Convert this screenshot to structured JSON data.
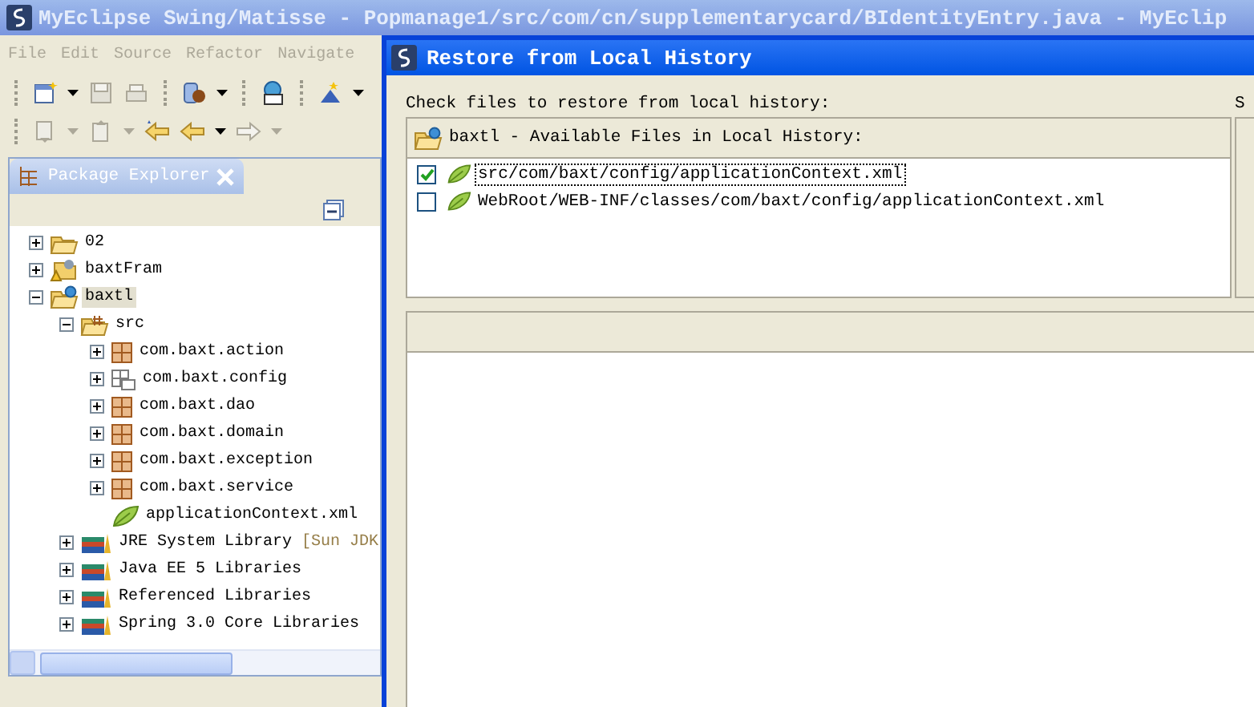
{
  "window": {
    "title": "MyEclipse Swing/Matisse - Popmanage1/src/com/cn/supplementarycard/BIdentityEntry.java - MyEclip"
  },
  "menu": [
    "File",
    "Edit",
    "Source",
    "Refactor",
    "Navigate"
  ],
  "package_explorer": {
    "title": "Package Explorer",
    "tree": [
      {
        "label": "02",
        "kind": "folder",
        "expanded": false,
        "selected": false
      },
      {
        "label": "baxtFram",
        "kind": "warning-project",
        "expanded": false,
        "selected": false
      },
      {
        "label": "baxtl",
        "kind": "project",
        "expanded": true,
        "selected": true,
        "children": [
          {
            "label": "src",
            "kind": "source-folder",
            "expanded": true,
            "selected": false,
            "children": [
              {
                "label": "com.baxt.action",
                "kind": "package",
                "expanded": false,
                "selected": false
              },
              {
                "label": "com.baxt.config",
                "kind": "empty-package",
                "expanded": false,
                "selected": false
              },
              {
                "label": "com.baxt.dao",
                "kind": "package",
                "expanded": false,
                "selected": false
              },
              {
                "label": "com.baxt.domain",
                "kind": "package",
                "expanded": false,
                "selected": false
              },
              {
                "label": "com.baxt.exception",
                "kind": "package",
                "expanded": false,
                "selected": false
              },
              {
                "label": "com.baxt.service",
                "kind": "package",
                "expanded": false,
                "selected": false
              },
              {
                "label": "applicationContext.xml",
                "kind": "spring-file",
                "selected": false
              }
            ]
          },
          {
            "label": "JRE System Library",
            "kind": "library",
            "expanded": false,
            "selected": false,
            "decoration": "[Sun JDK"
          },
          {
            "label": "Java EE 5 Libraries",
            "kind": "library",
            "expanded": false,
            "selected": false
          },
          {
            "label": "Referenced Libraries",
            "kind": "library",
            "expanded": false,
            "selected": false
          },
          {
            "label": "Spring 3.0 Core Libraries",
            "kind": "library",
            "expanded": false,
            "selected": false
          }
        ]
      }
    ]
  },
  "dialog": {
    "title": "Restore from Local History",
    "instruction": "Check files to restore from local history:",
    "side_label": "S",
    "files_header": "baxtl - Available Files in Local History:",
    "files": [
      {
        "path": "src/com/baxt/config/applicationContext.xml",
        "checked": true,
        "selected": true
      },
      {
        "path": "WebRoot/WEB-INF/classes/com/baxt/config/applicationContext.xml",
        "checked": false,
        "selected": false
      }
    ]
  }
}
